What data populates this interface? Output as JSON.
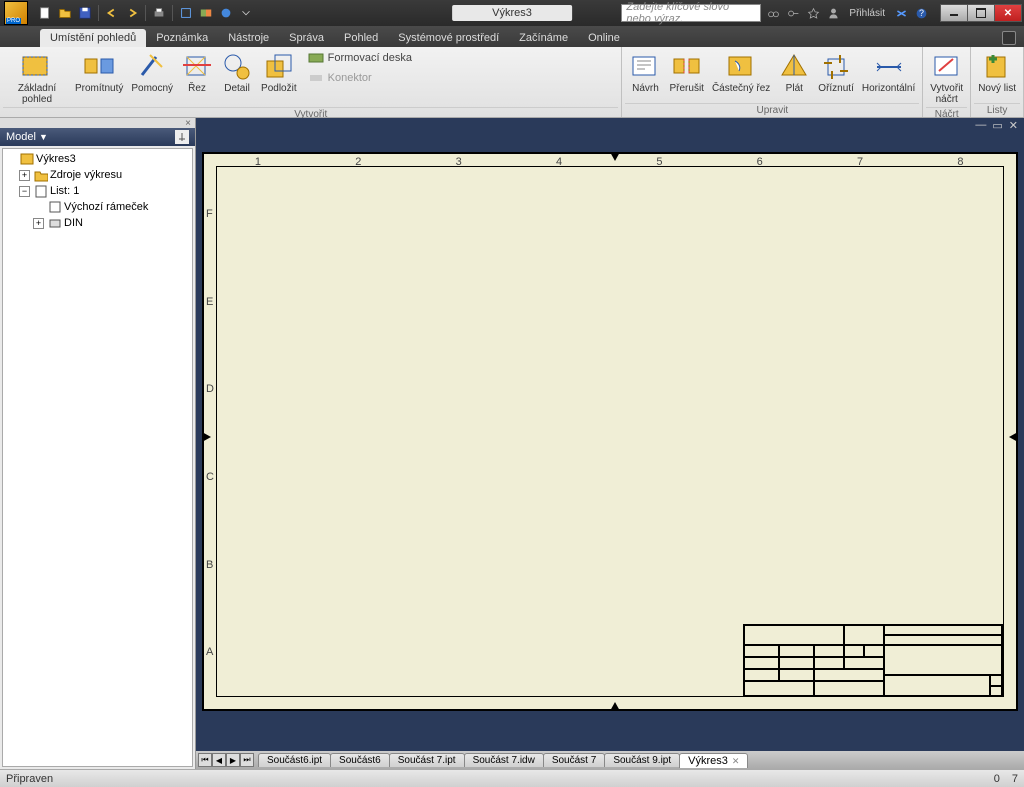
{
  "app": {
    "title": "Výkres3"
  },
  "search": {
    "placeholder": "Zadejte klíčové slovo nebo výraz."
  },
  "signin": "Přihlásit",
  "ribbonTabs": {
    "t0": "Umístění pohledů",
    "t1": "Poznámka",
    "t2": "Nástroje",
    "t3": "Správa",
    "t4": "Pohled",
    "t5": "Systémové prostředí",
    "t6": "Začínáme",
    "t7": "Online"
  },
  "ribbon": {
    "g1": {
      "label": "Vytvořit",
      "b0": "Základní pohled",
      "b1": "Promítnutý",
      "b2": "Pomocný",
      "b3": "Řez",
      "b4": "Detail",
      "b5": "Podložit",
      "s0": "Formovací deska",
      "s1": "Konektor"
    },
    "g2": {
      "label": "Upravit",
      "b0": "Návrh",
      "b1": "Přerušit",
      "b2": "Částečný řez",
      "b3": "Plát",
      "b4": "Oříznutí",
      "b5": "Horizontální"
    },
    "g3": {
      "label": "Náčrt",
      "b0": "Vytvořit\nnáčrt"
    },
    "g4": {
      "label": "Listy",
      "b0": "Nový list"
    }
  },
  "panel": {
    "title": "Model",
    "close": "×"
  },
  "tree": {
    "n0": "Výkres3",
    "n1": "Zdroje výkresu",
    "n2": "List: 1",
    "n3": "Výchozí rámeček",
    "n4": "DIN"
  },
  "docWin": {
    "min": "—",
    "max": "▭",
    "close": "✕"
  },
  "rulerH": {
    "m1": "1",
    "m2": "2",
    "m3": "3",
    "m4": "4",
    "m5": "5",
    "m6": "6",
    "m7": "7",
    "m8": "8"
  },
  "rulerV": {
    "a": "A",
    "b": "B",
    "c": "C",
    "d": "D",
    "e": "E",
    "f": "F"
  },
  "docTabs": {
    "t0": "Součást6.ipt",
    "t1": "Součást6",
    "t2": "Součást 7.ipt",
    "t3": "Součást 7.idw",
    "t4": "Součást 7",
    "t5": "Součást 9.ipt",
    "t6": "Výkres3"
  },
  "status": {
    "left": "Připraven",
    "r0": "0",
    "r1": "7"
  }
}
